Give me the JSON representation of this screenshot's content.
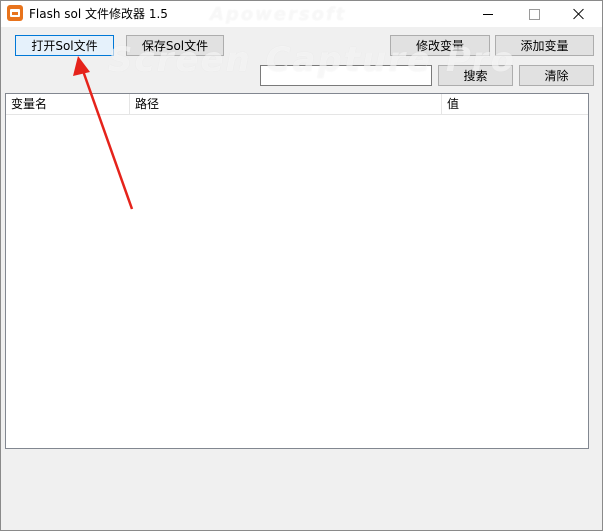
{
  "window": {
    "title": "Flash sol 文件修改器 1.5"
  },
  "toolbar": {
    "open_label": "打开Sol文件",
    "save_label": "保存Sol文件",
    "modify_label": "修改变量",
    "add_label": "添加变量",
    "search_label": "搜索",
    "clear_label": "清除"
  },
  "search": {
    "value": "",
    "placeholder": ""
  },
  "table": {
    "columns": [
      "变量名",
      "路径",
      "值"
    ],
    "rows": []
  },
  "watermark": {
    "line1": "Screen Capture Pro",
    "line2": "Apowersoft"
  },
  "annotation": {
    "arrow_color": "#e5231b"
  },
  "icons": {
    "app": "flash-sol-app-icon",
    "minimize": "minimize-icon",
    "maximize": "maximize-icon",
    "close": "close-icon"
  }
}
